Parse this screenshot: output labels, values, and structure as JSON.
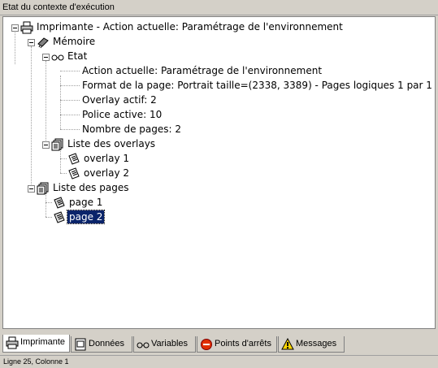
{
  "window_title": "Etat du contexte d'exécution",
  "tree": {
    "root_label": "Imprimante - Action actuelle: Paramétrage de l'environnement",
    "memoire_label": "Mémoire",
    "etat_label": "Etat",
    "etat_items": [
      "Action actuelle: Paramétrage de l'environnement",
      "Format de la page: Portrait taille=(2338, 3389) - Pages logiques 1 par 1",
      "Overlay actif: 2",
      "Police active: 10",
      "Nombre de pages: 2"
    ],
    "overlays_label": "Liste des overlays",
    "overlays": [
      "overlay 1",
      "overlay 2"
    ],
    "pages_label": "Liste des pages",
    "pages": [
      "page 1",
      "page 2"
    ],
    "selected_item": "page 2"
  },
  "tabs": [
    {
      "label": "Imprimante",
      "icon": "printer-icon",
      "active": true
    },
    {
      "label": "Données",
      "icon": "document-icon",
      "active": false
    },
    {
      "label": "Variables",
      "icon": "glasses-icon",
      "active": false
    },
    {
      "label": "Points d'arrêts",
      "icon": "stop-icon",
      "active": false
    },
    {
      "label": "Messages",
      "icon": "warning-icon",
      "active": false
    }
  ],
  "status": "Ligne 25, Colonne 1",
  "colors": {
    "selection": "#0a246a",
    "background": "#d4d0c8"
  }
}
